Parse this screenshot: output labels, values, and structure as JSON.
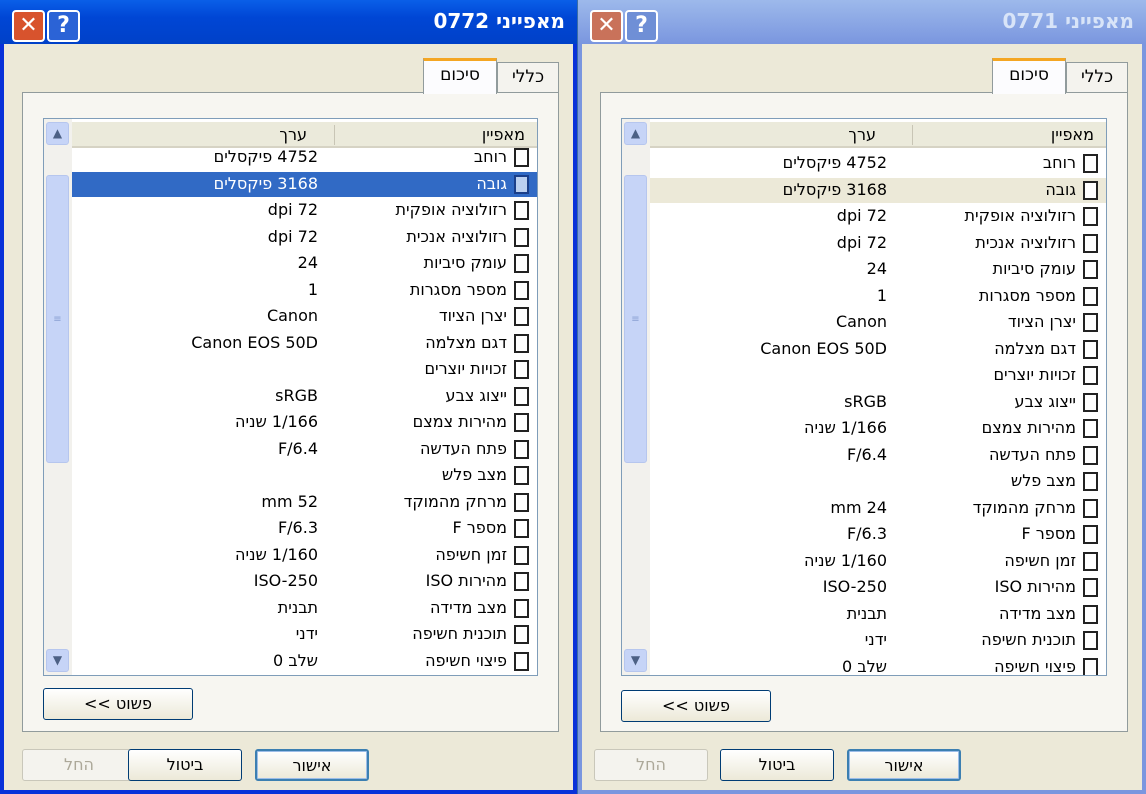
{
  "dialogs": [
    {
      "title": "מאפייני 0772",
      "active": true,
      "tabs": [
        "כללי",
        "סיכום"
      ],
      "active_tab": 1,
      "columns": {
        "property": "מאפיין",
        "value": "ערך"
      },
      "selected_row": 1,
      "rows": [
        {
          "property": "רוחב",
          "value": "4752 פיקסלים"
        },
        {
          "property": "גובה",
          "value": "3168 פיקסלים"
        },
        {
          "property": "רזולוציה אופקית",
          "value": "72 dpi"
        },
        {
          "property": "רזולוציה אנכית",
          "value": "72 dpi"
        },
        {
          "property": "עומק סיביות",
          "value": "24"
        },
        {
          "property": "מספר מסגרות",
          "value": "1"
        },
        {
          "property": "יצרן הציוד",
          "value": "Canon"
        },
        {
          "property": "דגם מצלמה",
          "value": "Canon EOS 50D"
        },
        {
          "property": "זכויות יוצרים",
          "value": ""
        },
        {
          "property": "ייצוג צבע",
          "value": "sRGB"
        },
        {
          "property": "מהירות צמצם",
          "value": "1/166 שניה"
        },
        {
          "property": "פתח העדשה",
          "value": "F/6.4"
        },
        {
          "property": "מצב פלש",
          "value": ""
        },
        {
          "property": "מרחק מהמוקד",
          "value": "52 mm"
        },
        {
          "property": "מספר F",
          "value": "F/6.3"
        },
        {
          "property": "זמן חשיפה",
          "value": "1/160 שניה"
        },
        {
          "property": "מהירות ISO",
          "value": "ISO-250"
        },
        {
          "property": "מצב מדידה",
          "value": "תבנית"
        },
        {
          "property": "תוכנית חשיפה",
          "value": "ידני"
        },
        {
          "property": "פיצוי חשיפה",
          "value": "שלב 0"
        }
      ],
      "simple_button": "<< פשוט",
      "ok": "אישור",
      "cancel": "ביטול",
      "apply": "החל"
    },
    {
      "title": "מאפייני 0771",
      "active": false,
      "tabs": [
        "כללי",
        "סיכום"
      ],
      "active_tab": 1,
      "columns": {
        "property": "מאפיין",
        "value": "ערך"
      },
      "selected_row": 1,
      "rows": [
        {
          "property": "רוחב",
          "value": "4752 פיקסלים"
        },
        {
          "property": "גובה",
          "value": "3168 פיקסלים"
        },
        {
          "property": "רזולוציה אופקית",
          "value": "72 dpi"
        },
        {
          "property": "רזולוציה אנכית",
          "value": "72 dpi"
        },
        {
          "property": "עומק סיביות",
          "value": "24"
        },
        {
          "property": "מספר מסגרות",
          "value": "1"
        },
        {
          "property": "יצרן הציוד",
          "value": "Canon"
        },
        {
          "property": "דגם מצלמה",
          "value": "Canon EOS 50D"
        },
        {
          "property": "זכויות יוצרים",
          "value": ""
        },
        {
          "property": "ייצוג צבע",
          "value": "sRGB"
        },
        {
          "property": "מהירות צמצם",
          "value": "1/166 שניה"
        },
        {
          "property": "פתח העדשה",
          "value": "F/6.4"
        },
        {
          "property": "מצב פלש",
          "value": ""
        },
        {
          "property": "מרחק מהמוקד",
          "value": "24 mm"
        },
        {
          "property": "מספר F",
          "value": "F/6.3"
        },
        {
          "property": "זמן חשיפה",
          "value": "1/160 שניה"
        },
        {
          "property": "מהירות ISO",
          "value": "ISO-250"
        },
        {
          "property": "מצב מדידה",
          "value": "תבנית"
        },
        {
          "property": "תוכנית חשיפה",
          "value": "ידני"
        },
        {
          "property": "פיצוי חשיפה",
          "value": "שלב 0"
        }
      ],
      "simple_button": "<< פשוט",
      "ok": "אישור",
      "cancel": "ביטול",
      "apply": "החל"
    }
  ]
}
